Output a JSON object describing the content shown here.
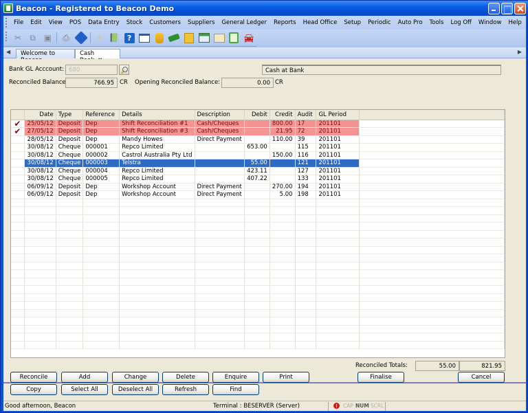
{
  "window": {
    "title": "Beacon - Registered to Beacon Demo"
  },
  "menu": [
    "File",
    "Edit",
    "View",
    "POS",
    "Data Entry",
    "Stock",
    "Customers",
    "Suppliers",
    "General Ledger",
    "Reports",
    "Head Office",
    "Setup",
    "Periodic",
    "Auto Pro",
    "Tools",
    "Log Off",
    "Window",
    "Help"
  ],
  "toolbar": {
    "icons": [
      "cut-icon",
      "copy-icon",
      "paste-icon",
      "print-icon",
      "info-icon",
      "disabled-icon",
      "book-icon",
      "help-icon",
      "chart-icon",
      "database-icon",
      "money-icon",
      "transfer-icon",
      "add-list-icon",
      "reconcile-icon",
      "document-icon",
      "car-icon"
    ]
  },
  "tabs": [
    {
      "label": "Welcome to Beacon",
      "active": false
    },
    {
      "label": "Cash Book",
      "active": true,
      "close": "✕"
    }
  ],
  "form": {
    "bank_gl_label": "Bank GL Acccount:",
    "bank_gl_value": "680",
    "account_name": "Cash at Bank",
    "reconciled_balance_label": "Reconciled Balance:",
    "reconciled_balance_value": "766.95",
    "reconciled_balance_suffix": "CR",
    "opening_label": "Opening Reconciled Balance:",
    "opening_value": "0.00",
    "opening_suffix": "CR"
  },
  "grid": {
    "columns": [
      "",
      "Date",
      "Type",
      "Reference",
      "Details",
      "Description",
      "Debit",
      "Credit",
      "Audit",
      "GL Period"
    ],
    "rows": [
      {
        "checked": true,
        "state": "red",
        "date": "25/05/12",
        "type": "Deposit",
        "ref": "Dep",
        "details": "Shift Reconciliation #1",
        "desc": "Cash/Cheques",
        "debit": "",
        "credit": "800.00",
        "audit": "17",
        "period": "201101"
      },
      {
        "checked": true,
        "state": "red",
        "date": "27/05/12",
        "type": "Deposit",
        "ref": "Dep",
        "details": "Shift Reconciliation #3",
        "desc": "Cash/Cheques",
        "debit": "",
        "credit": "21.95",
        "audit": "72",
        "period": "201101"
      },
      {
        "checked": false,
        "state": "",
        "date": "28/05/12",
        "type": "Deposit",
        "ref": "Dep",
        "details": "Mandy Howes",
        "desc": "Direct Payment",
        "debit": "",
        "credit": "110.00",
        "audit": "39",
        "period": "201101"
      },
      {
        "checked": false,
        "state": "",
        "date": "30/08/12",
        "type": "Cheque",
        "ref": "000001",
        "details": "Repco Limited",
        "desc": "",
        "debit": "653.00",
        "credit": "",
        "audit": "115",
        "period": "201101"
      },
      {
        "checked": false,
        "state": "",
        "date": "30/08/12",
        "type": "Cheque",
        "ref": "000002",
        "details": "Castrol Australia Pty Ltd",
        "desc": "",
        "debit": "",
        "credit": "150.00",
        "audit": "116",
        "period": "201101"
      },
      {
        "checked": true,
        "state": "sel",
        "date": "30/08/12",
        "type": "Cheque",
        "ref": "000003",
        "details": "Telstra",
        "desc": "",
        "debit": "55.00",
        "credit": "",
        "audit": "121",
        "period": "201101"
      },
      {
        "checked": false,
        "state": "",
        "date": "30/08/12",
        "type": "Cheque",
        "ref": "000004",
        "details": "Repco Limited",
        "desc": "",
        "debit": "423.11",
        "credit": "",
        "audit": "127",
        "period": "201101"
      },
      {
        "checked": false,
        "state": "",
        "date": "30/08/12",
        "type": "Cheque",
        "ref": "000005",
        "details": "Repco Limited",
        "desc": "",
        "debit": "407.22",
        "credit": "",
        "audit": "133",
        "period": "201101"
      },
      {
        "checked": false,
        "state": "",
        "date": "06/09/12",
        "type": "Deposit",
        "ref": "Dep",
        "details": "Workshop Account",
        "desc": "Direct Payment",
        "debit": "",
        "credit": "270.00",
        "audit": "194",
        "period": "201101"
      },
      {
        "checked": false,
        "state": "",
        "date": "06/09/12",
        "type": "Deposit",
        "ref": "Dep",
        "details": "Workshop Account",
        "desc": "Direct Payment",
        "debit": "",
        "credit": "5.00",
        "audit": "198",
        "period": "201101"
      }
    ],
    "check_glyph": "✔",
    "empty_rows": 19
  },
  "totals": {
    "label": "Reconciled Totals:",
    "debit": "55.00",
    "credit": "821.95"
  },
  "buttons": {
    "reconcile": "Reconcile",
    "add": "Add",
    "change": "Change",
    "delete": "Delete",
    "enquire": "Enquire",
    "print": "Print",
    "finalise": "Finalise",
    "cancel": "Cancel",
    "copy": "Copy",
    "select_all": "Select All",
    "deselect_all": "Deselect All",
    "refresh": "Refresh",
    "find": "Find"
  },
  "status": {
    "greeting": "Good afternoon, Beacon",
    "terminal": "Terminal : BESERVER (Server)",
    "cap": "CAP",
    "num": "NUM",
    "scrl": "SCRL"
  },
  "colors": {
    "selected_row": "#316ac5",
    "reconciled_row": "#f59393",
    "check": "#c40a1e"
  }
}
